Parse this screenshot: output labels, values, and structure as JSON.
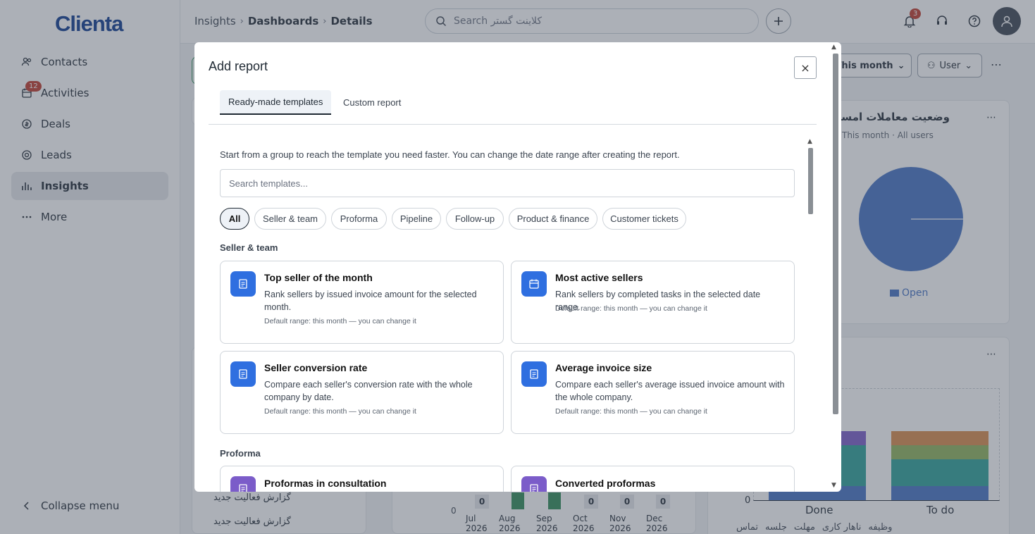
{
  "app": {
    "logo": "Clienta"
  },
  "sidebar": {
    "items": [
      {
        "label": "Contacts",
        "icon": "contacts-icon"
      },
      {
        "label": "Activities",
        "icon": "calendar-icon",
        "badge": "12"
      },
      {
        "label": "Deals",
        "icon": "deals-icon"
      },
      {
        "label": "Leads",
        "icon": "leads-icon"
      },
      {
        "label": "Insights",
        "icon": "chart-bars-icon",
        "active": true
      },
      {
        "label": "More",
        "icon": "more-dots-icon"
      }
    ],
    "collapse_label": "Collapse menu",
    "bottom_items": [
      "گزارش فعالیت جدید",
      "گزارش فعالیت جدید"
    ]
  },
  "topbar": {
    "breadcrumb": [
      "Insights",
      "Dashboards",
      "Details"
    ],
    "search_placeholder": "Search کلاینت گستر",
    "notif_count": "3"
  },
  "dashboard": {
    "range_filter": "This month",
    "user_filter": "User",
    "pie_card": {
      "title": "وضعیت معاملات امسال",
      "subtitle": "This month · All users",
      "legend": "Open"
    },
    "bar_card": {
      "categories": [
        "Done",
        "To do"
      ],
      "y_zero": "0",
      "legend": [
        "تماس",
        "جلسه",
        "مهلت",
        "ناهار کاری",
        "وظیفه"
      ]
    },
    "month_card": {
      "months": [
        "Jul 2026",
        "Aug 2026",
        "Sep 2026",
        "Oct 2026",
        "Nov 2026",
        "Dec 2026"
      ],
      "values": [
        "0",
        "",
        "",
        "0",
        "0",
        "0"
      ],
      "y_zero": "0"
    }
  },
  "colors": {
    "accent": "#2f6fe0",
    "purple": "#7b5cc9",
    "pie": "#4472c4",
    "green": "#2e8b57"
  },
  "modal": {
    "title": "Add report",
    "close": "×",
    "tabs": [
      "Ready-made templates",
      "Custom report"
    ],
    "intro": "Start from a group to reach the template you need faster. You can change the date range after creating the report.",
    "search_placeholder": "Search templates...",
    "chips": [
      "All",
      "Seller & team",
      "Proforma",
      "Pipeline",
      "Follow-up",
      "Product & finance",
      "Customer tickets"
    ],
    "sections": [
      {
        "title": "Seller & team"
      },
      {
        "title": "Proforma"
      }
    ],
    "templates": [
      {
        "title": "Top seller of the month",
        "desc": "Rank sellers by issued invoice amount for the selected month.",
        "default": "Default range: this month — you can change it"
      },
      {
        "title": "Most active sellers",
        "desc": "Rank sellers by completed tasks in the selected date range.",
        "default": "Default range: this month — you can change it"
      },
      {
        "title": "Seller conversion rate",
        "desc": "Compare each seller's conversion rate with the whole company by date.",
        "default": "Default range: this month — you can change it"
      },
      {
        "title": "Average invoice size",
        "desc": "Compare each seller's average issued invoice amount with the whole company.",
        "default": "Default range: this month — you can change it"
      },
      {
        "title": "Proformas in consultation"
      },
      {
        "title": "Converted proformas"
      }
    ]
  }
}
